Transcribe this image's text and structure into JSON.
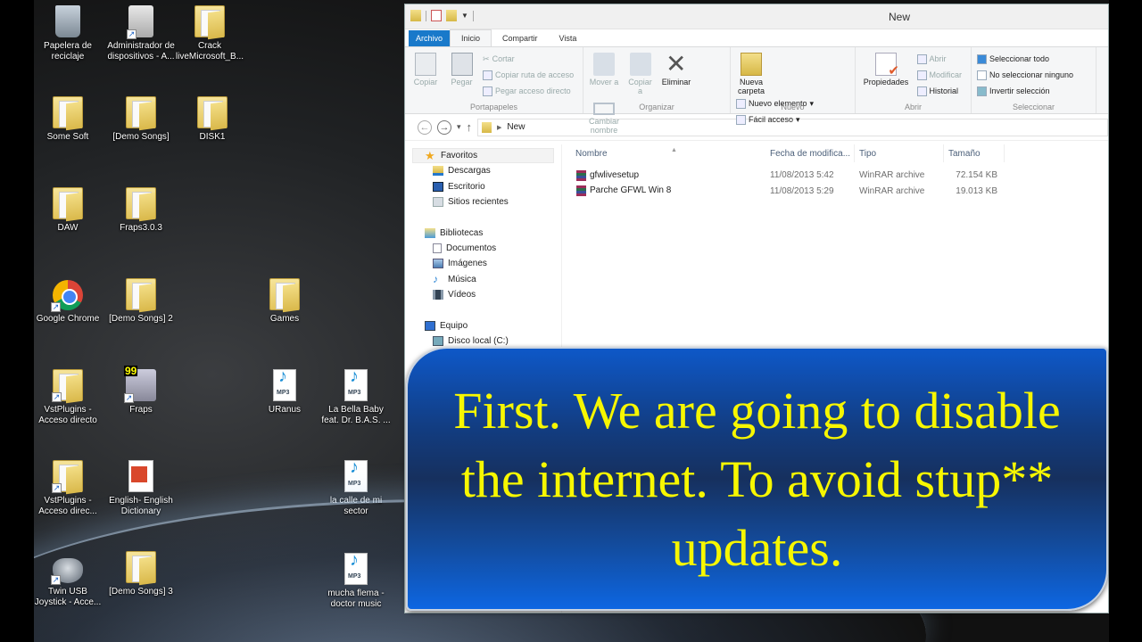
{
  "desktop": {
    "icons": [
      {
        "label": "Papelera de reciclaje",
        "icon": "recycle-bin-icon"
      },
      {
        "label": "Administrador de dispositivos - A...",
        "icon": "device-manager-icon"
      },
      {
        "label": "Crack liveMicrosoft_B...",
        "icon": "folder-icon"
      },
      {
        "label": "Some Soft",
        "icon": "folder-icon"
      },
      {
        "label": "[Demo Songs]",
        "icon": "folder-icon"
      },
      {
        "label": "DISK1",
        "icon": "folder-icon"
      },
      {
        "label": "DAW",
        "icon": "folder-icon"
      },
      {
        "label": "Fraps3.0.3",
        "icon": "folder-icon"
      },
      {
        "label": "Google Chrome",
        "icon": "chrome-icon"
      },
      {
        "label": "[Demo Songs] 2",
        "icon": "folder-icon"
      },
      {
        "label": "Games",
        "icon": "folder-icon"
      },
      {
        "label": "VstPlugins - Acceso directo",
        "icon": "folder-shortcut-icon"
      },
      {
        "label": "Fraps",
        "icon": "fraps-icon"
      },
      {
        "label": "URanus",
        "icon": "mp3-icon"
      },
      {
        "label": "La Bella Baby feat. Dr. B.A.S. ...",
        "icon": "mp3-icon"
      },
      {
        "label": "VstPlugins - Acceso direc...",
        "icon": "folder-shortcut-icon"
      },
      {
        "label": "English- English Dictionary",
        "icon": "dictionary-icon"
      },
      {
        "label": "la calle de mi sector",
        "icon": "mp3-icon"
      },
      {
        "label": "Twin USB Joystick - Acce...",
        "icon": "joystick-icon"
      },
      {
        "label": "[Demo Songs] 3",
        "icon": "folder-icon"
      },
      {
        "label": "mucha flema - doctor music",
        "icon": "mp3-icon"
      }
    ]
  },
  "explorer": {
    "title": "New",
    "tabs": [
      {
        "label": "Archivo"
      },
      {
        "label": "Inicio"
      },
      {
        "label": "Compartir"
      },
      {
        "label": "Vista"
      }
    ],
    "ribbon": {
      "portapapeles": {
        "label": "Portapapeles",
        "copiar": "Copiar",
        "pegar": "Pegar",
        "cortar": "Cortar",
        "copiar_ruta": "Copiar ruta de acceso",
        "pegar_acceso": "Pegar acceso directo"
      },
      "organizar": {
        "label": "Organizar",
        "mover": "Mover a",
        "copiar": "Copiar a",
        "eliminar": "Eliminar",
        "cambiar": "Cambiar nombre"
      },
      "nuevo": {
        "label": "Nuevo",
        "nueva_carpeta": "Nueva carpeta",
        "nuevo_elemento": "Nuevo elemento",
        "facil_acceso": "Fácil acceso"
      },
      "abrir": {
        "label": "Abrir",
        "propiedades": "Propiedades",
        "abrir": "Abrir",
        "modificar": "Modificar",
        "historial": "Historial"
      },
      "seleccionar": {
        "label": "Seleccionar",
        "todo": "Seleccionar todo",
        "ninguno": "No seleccionar ninguno",
        "invertir": "Invertir selección"
      }
    },
    "address": {
      "path": [
        "New"
      ]
    },
    "nav": {
      "favoritos": "Favoritos",
      "favoritos_items": [
        "Descargas",
        "Escritorio",
        "Sitios recientes"
      ],
      "bibliotecas": "Bibliotecas",
      "bibliotecas_items": [
        "Documentos",
        "Imágenes",
        "Música",
        "Vídeos"
      ],
      "equipo": "Equipo",
      "equipo_items": [
        "Disco local (C:)"
      ]
    },
    "columns": [
      "Nombre",
      "Fecha de modifica...",
      "Tipo",
      "Tamaño"
    ],
    "files": [
      {
        "name": "gfwlivesetup",
        "date": "11/08/2013 5:42",
        "type": "WinRAR archive",
        "size": "72.154 KB"
      },
      {
        "name": "Parche GFWL Win 8",
        "date": "11/08/2013 5:29",
        "type": "WinRAR archive",
        "size": "19.013 KB"
      }
    ]
  },
  "caption": {
    "text": "First. We are going to disable the internet. To avoid stup** updates.",
    "text_color": "#f7f700",
    "bg_color": "#16305e"
  }
}
